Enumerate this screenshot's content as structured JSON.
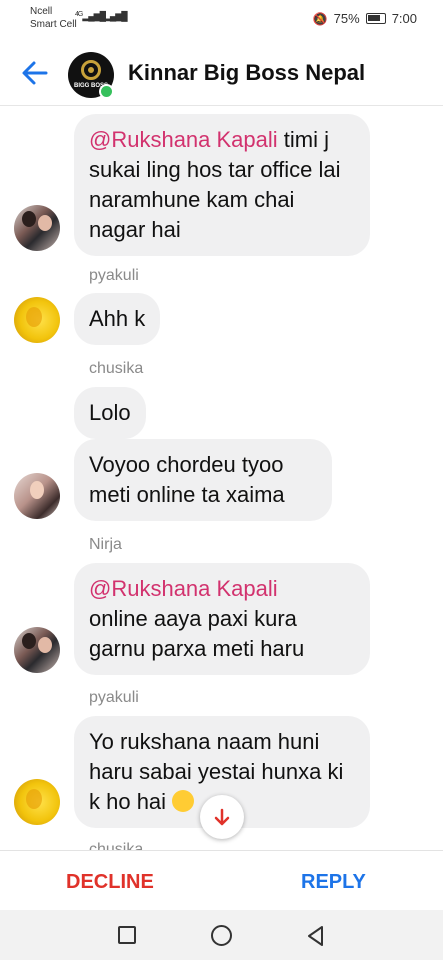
{
  "status_bar": {
    "carrier_1": "Ncell",
    "carrier_2": "Smart Cell",
    "network_type": "4G",
    "battery": "75%",
    "time": "7:00"
  },
  "header": {
    "back_icon": "arrow-left-icon",
    "title": "Kinnar Big Boss Nepal",
    "avatar_text": "BIGG BOSS",
    "accent_color": "#1d74e8"
  },
  "messages": [
    {
      "mention": "@Rukshana Kapali",
      "text": " timi j sukai ling hos tar office lai naramhune kam chai nagar hai"
    },
    {
      "sender": "pyakuli",
      "text": "Ahh k"
    },
    {
      "sender": "chusika",
      "text": "Lolo"
    },
    {
      "text": "Voyoo chordeu tyoo meti online ta xaima"
    },
    {
      "sender": "Nirja",
      "mention": "@Rukshana Kapali",
      "text": "online aaya paxi kura garnu parxa meti haru"
    },
    {
      "sender": "pyakuli",
      "text": "Yo rukshana naam huni haru sabai yestai hunxa ki k ho hai"
    },
    {
      "sender": "chusika"
    }
  ],
  "actions": {
    "decline_label": "DECLINE",
    "decline_color": "#e0322a",
    "reply_label": "REPLY",
    "reply_color": "#1d74e8"
  },
  "nav": {
    "recents_icon": "square-icon",
    "home_icon": "circle-icon",
    "back_icon": "triangle-back-icon"
  }
}
